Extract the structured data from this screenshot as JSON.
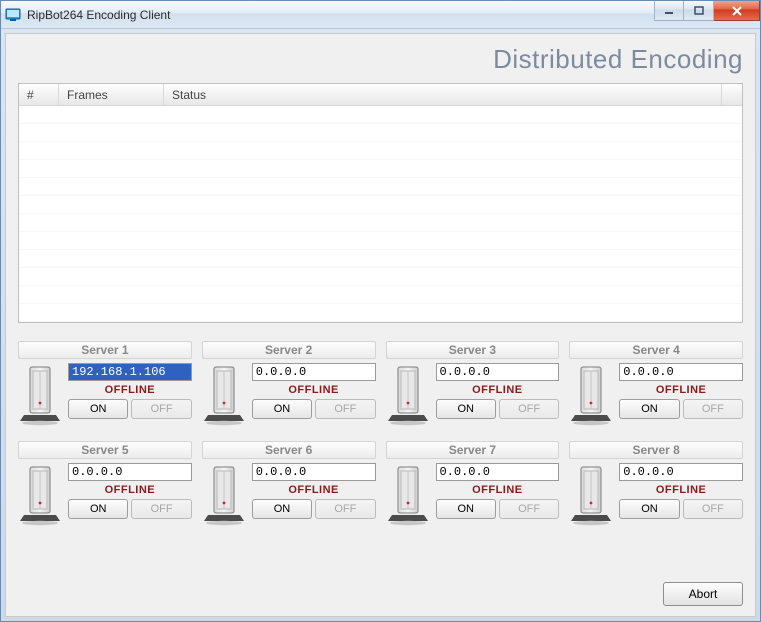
{
  "window": {
    "title": "RipBot264 Encoding Client"
  },
  "page_title": "Distributed Encoding",
  "grid": {
    "columns": {
      "num": "#",
      "frames": "Frames",
      "status": "Status"
    }
  },
  "servers": [
    {
      "label": "Server 1",
      "ip": "192.168.1.106",
      "status": "OFFLINE",
      "selected": true
    },
    {
      "label": "Server 2",
      "ip": "0.0.0.0",
      "status": "OFFLINE",
      "selected": false
    },
    {
      "label": "Server 3",
      "ip": "0.0.0.0",
      "status": "OFFLINE",
      "selected": false
    },
    {
      "label": "Server 4",
      "ip": "0.0.0.0",
      "status": "OFFLINE",
      "selected": false
    },
    {
      "label": "Server 5",
      "ip": "0.0.0.0",
      "status": "OFFLINE",
      "selected": false
    },
    {
      "label": "Server 6",
      "ip": "0.0.0.0",
      "status": "OFFLINE",
      "selected": false
    },
    {
      "label": "Server 7",
      "ip": "0.0.0.0",
      "status": "OFFLINE",
      "selected": false
    },
    {
      "label": "Server 8",
      "ip": "0.0.0.0",
      "status": "OFFLINE",
      "selected": false
    }
  ],
  "buttons": {
    "on": "ON",
    "off": "OFF",
    "abort": "Abort"
  }
}
